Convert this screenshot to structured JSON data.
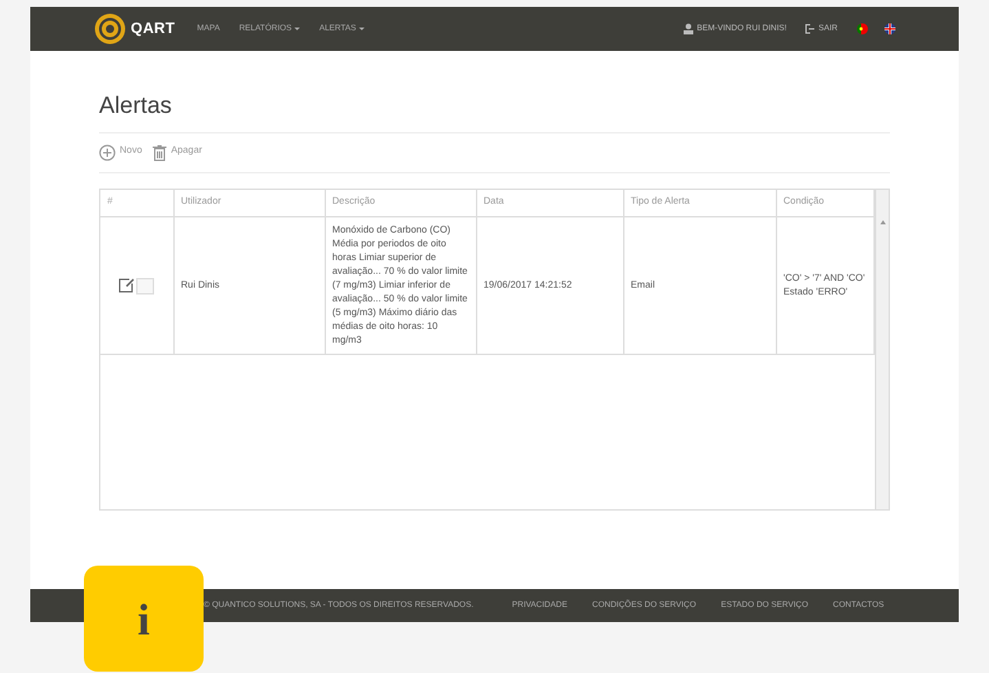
{
  "navbar": {
    "logo": "QART",
    "menu": [
      {
        "label": "MAPA",
        "dropdown": false
      },
      {
        "label": "RELATÓRIOS",
        "dropdown": true
      },
      {
        "label": "ALERTAS",
        "dropdown": true
      }
    ],
    "user": "BEM-VINDO RUI DINIS!",
    "logout": "SAIR",
    "languages": [
      {
        "kind": "pt"
      },
      {
        "kind": "en"
      }
    ]
  },
  "page_title": "Alertas",
  "toolbar": [
    {
      "kind": "add",
      "label": "Novo"
    },
    {
      "kind": "delete",
      "label": "Apagar"
    }
  ],
  "table": {
    "columns": [
      "#",
      "Utilizador",
      "Descrição",
      "Data",
      "Tipo de Alerta",
      "Condição"
    ],
    "rows": [
      {
        "checked": false,
        "user": "Rui Dinis",
        "description": "Monóxido de Carbono (CO) Média por periodos de oito horas Limiar superior de avaliação... 70 % do valor limite (7 mg/m3) Limiar inferior de avaliação... 50 % do valor limite (5 mg/m3) Máximo diário das médias de oito horas: 10 mg/m3",
        "date": "19/06/2017 14:21:52",
        "type": "Email",
        "condition": "'CO' > '7' AND 'CO' Estado 'ERRO'"
      }
    ]
  },
  "footer": {
    "copyright": "© QUANTICO SOLUTIONS, SA - TODOS OS DIREITOS RESERVADOS.",
    "links": [
      "PRIVACIDADE",
      "CONDIÇÕES DO SERVIÇO",
      "ESTADO DO SERVIÇO",
      "CONTACTOS"
    ]
  },
  "info_badge": "i"
}
